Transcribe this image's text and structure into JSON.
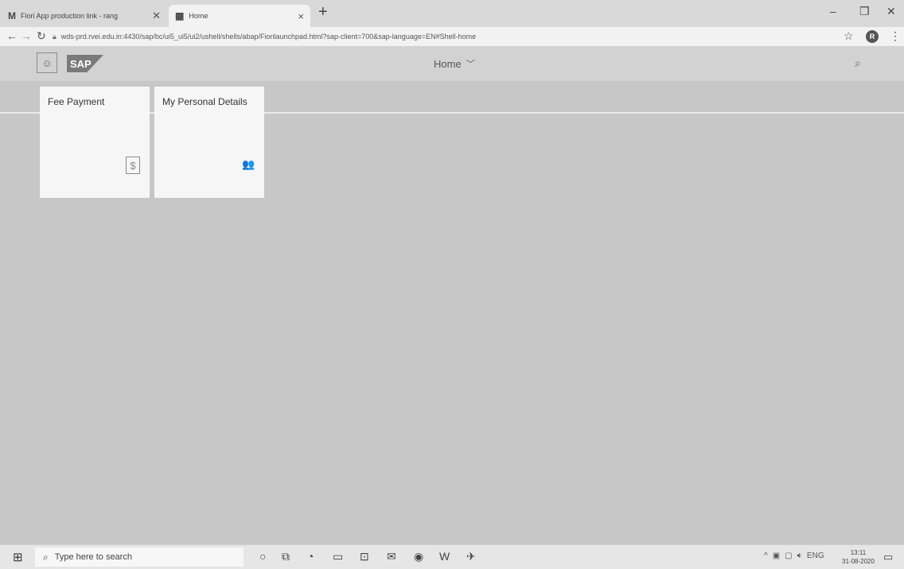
{
  "browser": {
    "tabs": [
      {
        "favicon": "M",
        "title": "Fiori App production link - rang",
        "close": "✕"
      },
      {
        "favicon": "▦",
        "title": "Home",
        "close": "×"
      }
    ],
    "new_tab": "+",
    "url": "wds-prd.rvei.edu.in:4430/sap/bc/ui5_ui5/ui2/ushell/shells/abap/Fiorilaunchpad.html?sap-client=700&sap-language=EN#Shell-home",
    "profile_initial": "R"
  },
  "shell": {
    "logo": "SAP",
    "title": "Home"
  },
  "tiles": [
    {
      "title": "Fee Payment",
      "icon": "document-dollar-icon",
      "glyph": "$"
    },
    {
      "title": "My Personal Details",
      "icon": "people-icon",
      "glyph": "👥"
    }
  ],
  "taskbar": {
    "search_placeholder": "Type here to search",
    "language": "ENG",
    "time": "13:11",
    "date": "31-08-2020"
  }
}
